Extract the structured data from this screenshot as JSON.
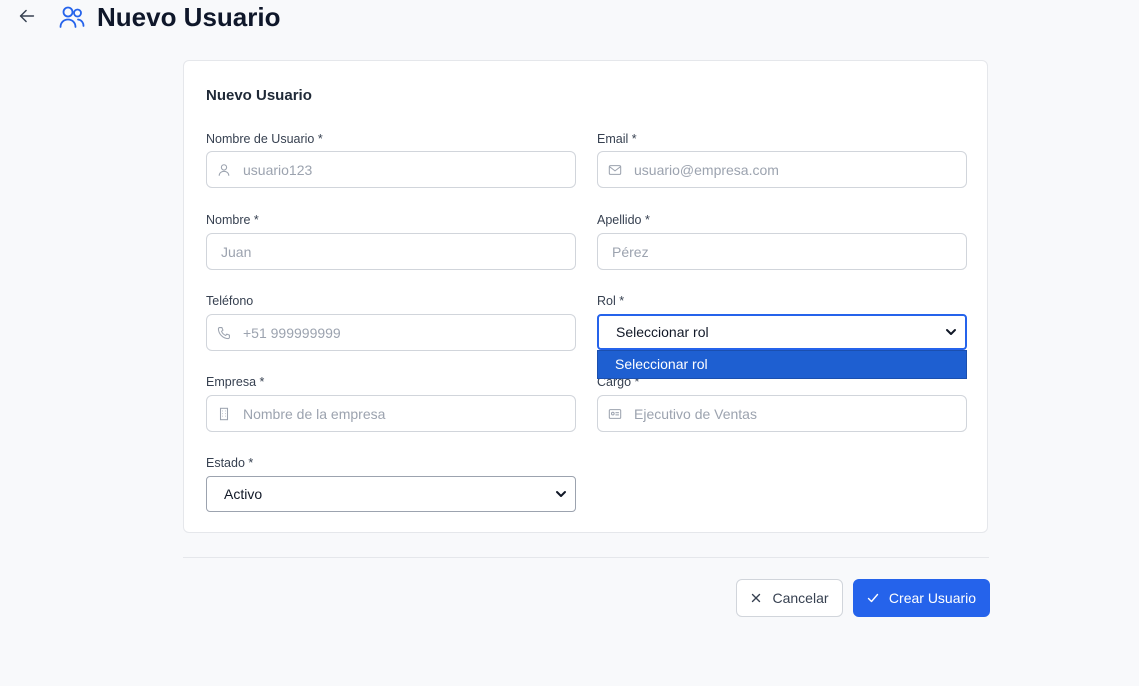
{
  "header": {
    "title": "Nuevo Usuario"
  },
  "form": {
    "title": "Nuevo Usuario",
    "fields": {
      "username": {
        "label": "Nombre de Usuario *",
        "placeholder": "usuario123",
        "value": ""
      },
      "email": {
        "label": "Email *",
        "placeholder": "usuario@empresa.com",
        "value": ""
      },
      "first_name": {
        "label": "Nombre *",
        "placeholder": "Juan",
        "value": ""
      },
      "last_name": {
        "label": "Apellido *",
        "placeholder": "Pérez",
        "value": ""
      },
      "phone": {
        "label": "Teléfono",
        "placeholder": "+51 999999999",
        "value": ""
      },
      "role": {
        "label": "Rol *",
        "selected": "Seleccionar rol",
        "options_visible": [
          "Seleccionar rol"
        ]
      },
      "company": {
        "label": "Empresa *",
        "placeholder": "Nombre de la empresa",
        "value": ""
      },
      "position": {
        "label": "Cargo *",
        "placeholder": "Ejecutivo de Ventas",
        "value": ""
      },
      "status": {
        "label": "Estado *",
        "selected": "Activo"
      }
    }
  },
  "actions": {
    "cancel_label": "Cancelar",
    "create_label": "Crear Usuario"
  },
  "colors": {
    "primary": "#2563eb",
    "dropdown_highlight": "#1e5fd1",
    "border": "#d1d5db",
    "background": "#f8f9fb"
  },
  "icons": {
    "back": "arrow-left-icon",
    "users": "users-icon",
    "user": "user-icon",
    "mail": "mail-icon",
    "phone": "phone-icon",
    "building": "building-icon",
    "id_card": "id-card-icon",
    "chevron": "chevron-down-icon",
    "close": "x-icon",
    "check": "check-icon"
  }
}
